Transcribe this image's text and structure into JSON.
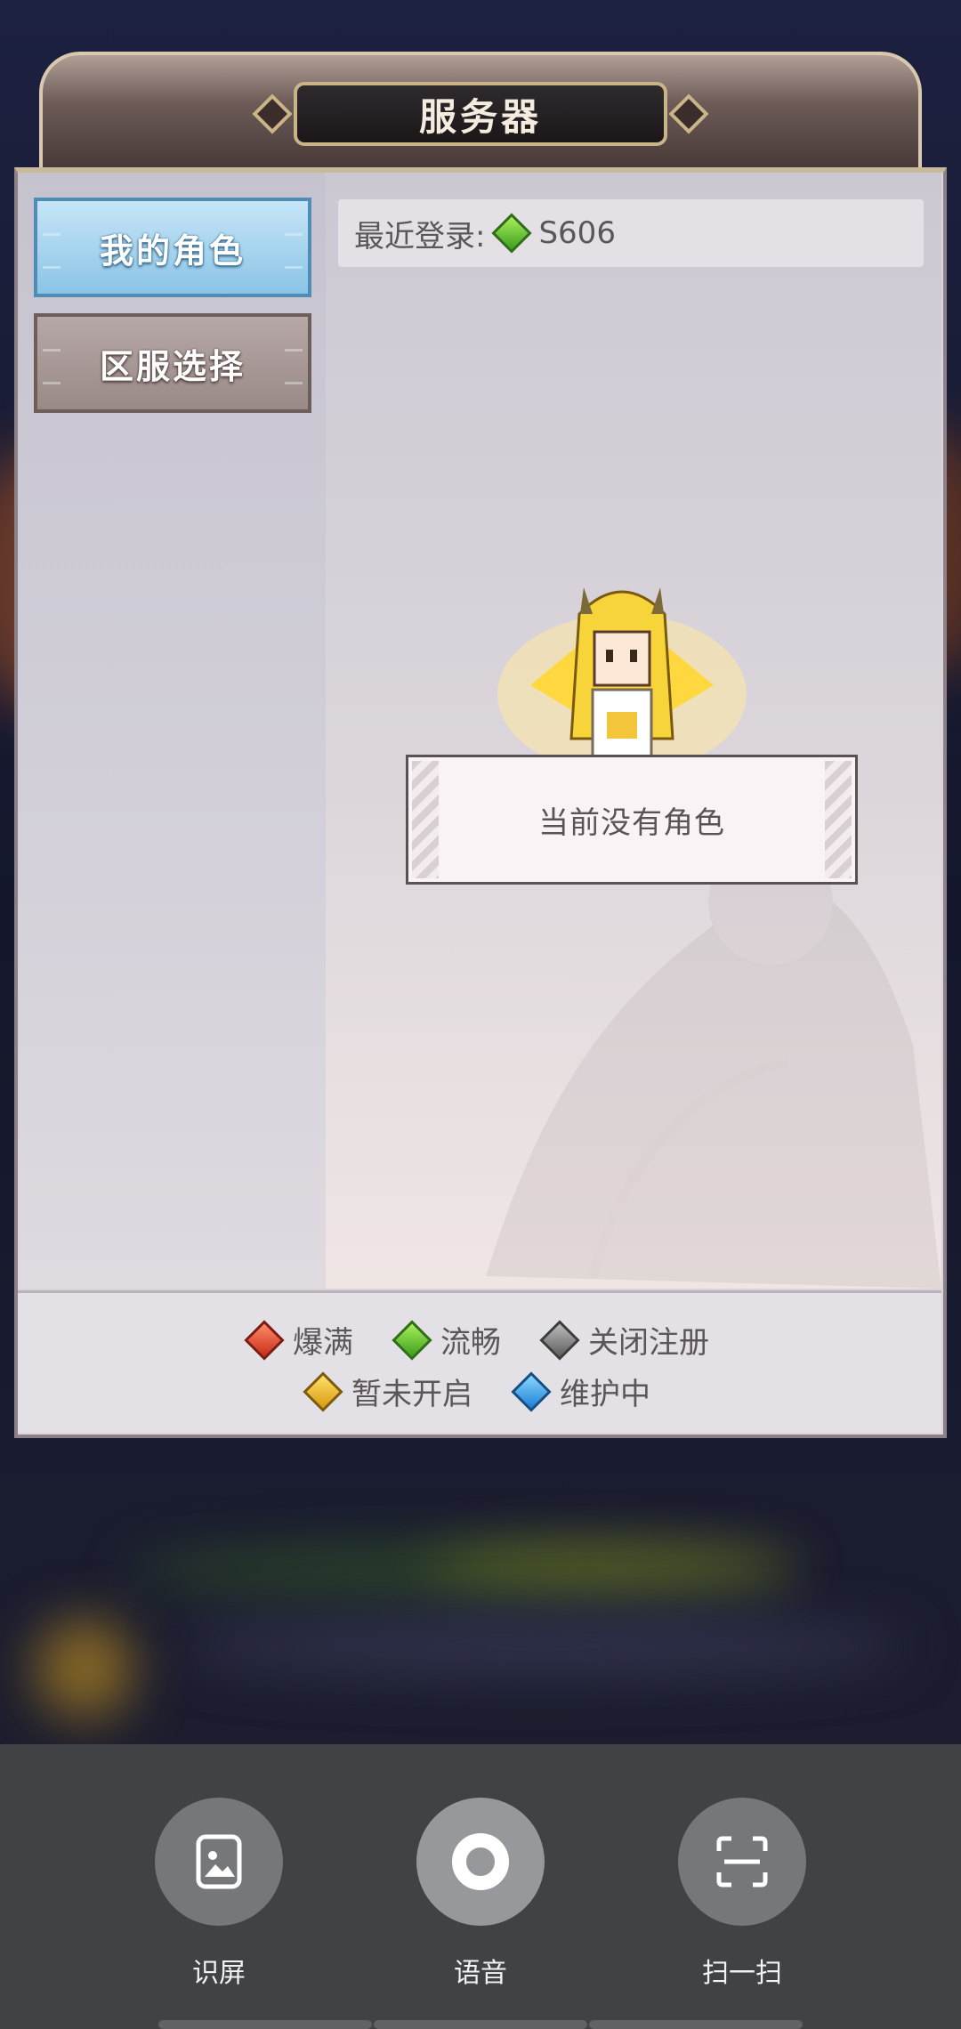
{
  "panel": {
    "title": "服务器"
  },
  "sidebar": {
    "items": [
      {
        "label": "我的角色",
        "active": true
      },
      {
        "label": "区服选择",
        "active": false
      }
    ]
  },
  "recent": {
    "label": "最近登录:",
    "server": "S606",
    "status_icon": "green-gem-icon"
  },
  "main": {
    "empty_message": "当前没有角色"
  },
  "legend": {
    "row1": [
      {
        "label": "爆满",
        "color": "#c92b16",
        "icon": "red-gem-icon"
      },
      {
        "label": "流畅",
        "color": "#3d9e1b",
        "icon": "green-gem-icon"
      },
      {
        "label": "关闭注册",
        "color": "#5d5d5d",
        "icon": "gray-gem-icon"
      }
    ],
    "row2": [
      {
        "label": "暂未开启",
        "color": "#d89b10",
        "icon": "yellow-gem-icon"
      },
      {
        "label": "维护中",
        "color": "#1c7fd5",
        "icon": "blue-gem-icon"
      }
    ]
  },
  "sheet": {
    "actions": [
      {
        "label": "识屏",
        "icon": "screen-image-icon"
      },
      {
        "label": "语音",
        "icon": "voice-ring-icon"
      },
      {
        "label": "扫一扫",
        "icon": "scan-icon"
      }
    ]
  }
}
